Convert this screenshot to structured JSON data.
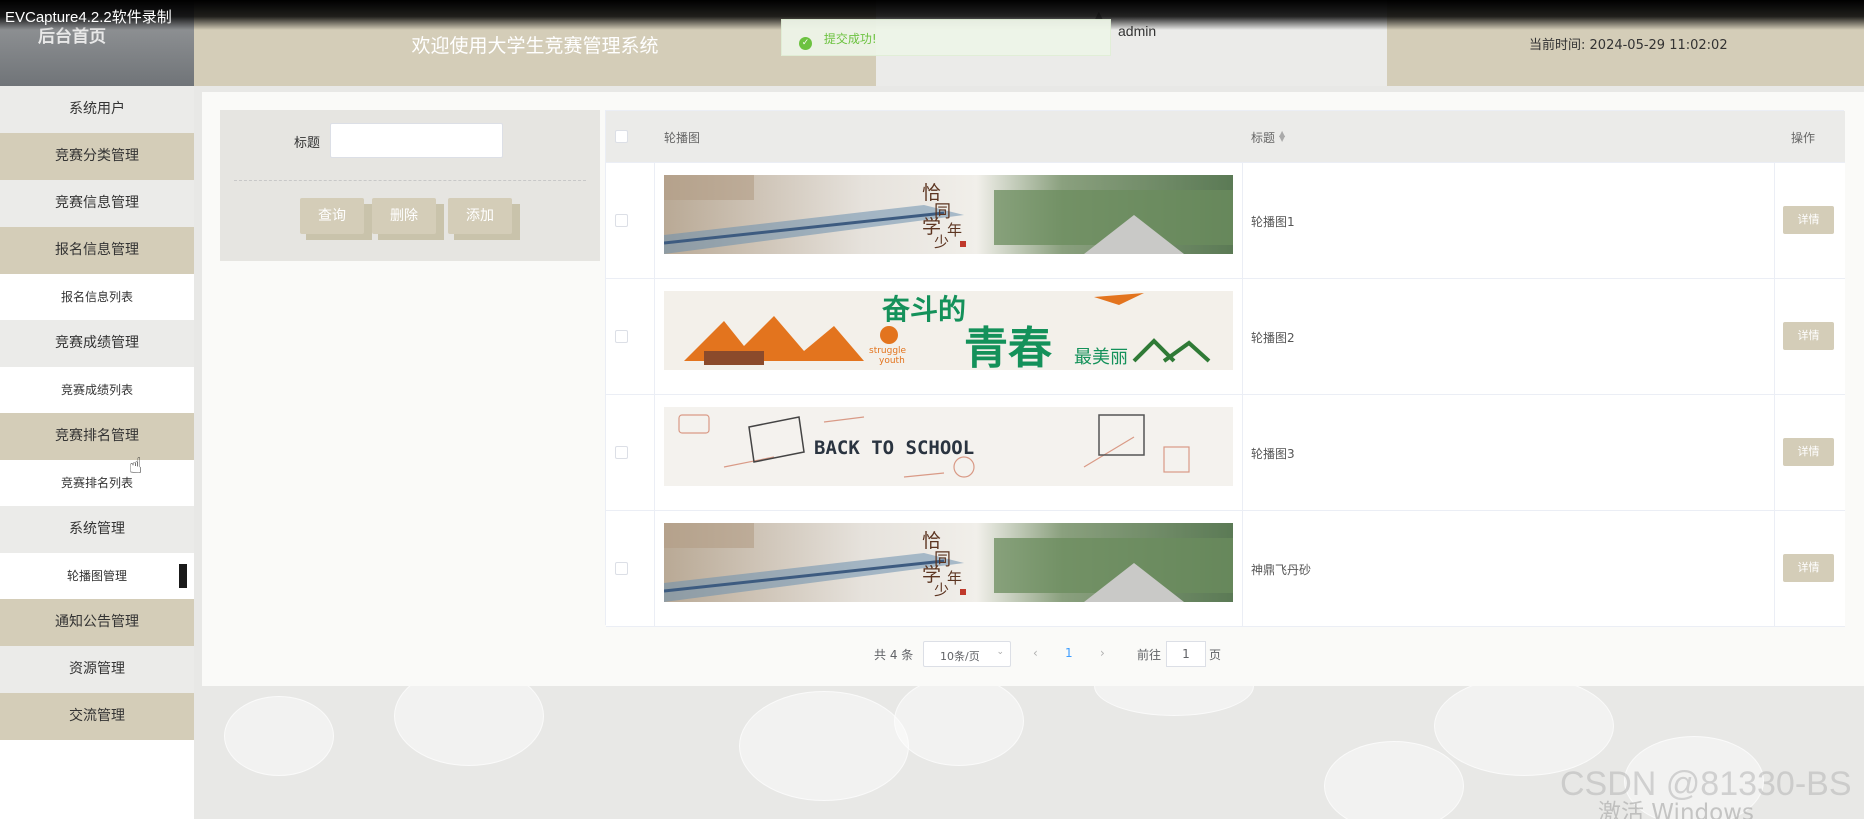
{
  "recorder": {
    "title": "EVCapture4.2.2软件录制"
  },
  "header": {
    "brand": "后台首页",
    "welcome": "欢迎使用大学生竞赛管理系统",
    "user": "admin",
    "time_label": "当前时间:",
    "time_value": "2024-05-29 11:02:02"
  },
  "toast": {
    "message": "提交成功!",
    "status_color": "#67c23a"
  },
  "sidebar": {
    "items": [
      {
        "label": "系统用户"
      },
      {
        "label": "竞赛分类管理"
      },
      {
        "label": "竞赛信息管理"
      },
      {
        "label": "报名信息管理"
      },
      {
        "label": "报名信息列表"
      },
      {
        "label": "竞赛成绩管理"
      },
      {
        "label": "竞赛成绩列表"
      },
      {
        "label": "竞赛排名管理"
      },
      {
        "label": "竞赛排名列表"
      },
      {
        "label": "系统管理"
      },
      {
        "label": "轮播图管理"
      },
      {
        "label": "通知公告管理"
      },
      {
        "label": "资源管理"
      },
      {
        "label": "交流管理"
      }
    ]
  },
  "search": {
    "title_label": "标题",
    "title_value": "",
    "query_label": "查询",
    "delete_label": "删除",
    "add_label": "添加"
  },
  "table": {
    "columns": {
      "image": "轮播图",
      "title": "标题",
      "action": "操作"
    },
    "rows": [
      {
        "title": "轮播图1",
        "action": "详情"
      },
      {
        "title": "轮播图2",
        "action": "详情"
      },
      {
        "title": "轮播图3",
        "action": "详情"
      },
      {
        "title": "神鼎飞丹砂",
        "action": "详情"
      }
    ]
  },
  "banners": {
    "b1": {
      "l1": "恰",
      "l2": "同",
      "l3": "学",
      "l4": "少",
      "l5": "年"
    },
    "b2": {
      "top": "奋斗的",
      "big": "青春",
      "side": "最美丽",
      "en1": "struggle",
      "en2": "youth"
    },
    "b3": {
      "text": "BACK TO SCHOOL"
    }
  },
  "pagination": {
    "total_text": "共 4 条",
    "page_size": "10条/页",
    "prev": "‹",
    "current_page": "1",
    "next": "›",
    "goto_prefix": "前往",
    "goto_value": "1",
    "goto_suffix": "页"
  },
  "watermark": {
    "text": "CSDN @81330-BS",
    "activate": "激活 Windows"
  },
  "colors": {
    "accent": "#d4cdb8",
    "light": "#ebebe9",
    "link": "#409eff"
  }
}
